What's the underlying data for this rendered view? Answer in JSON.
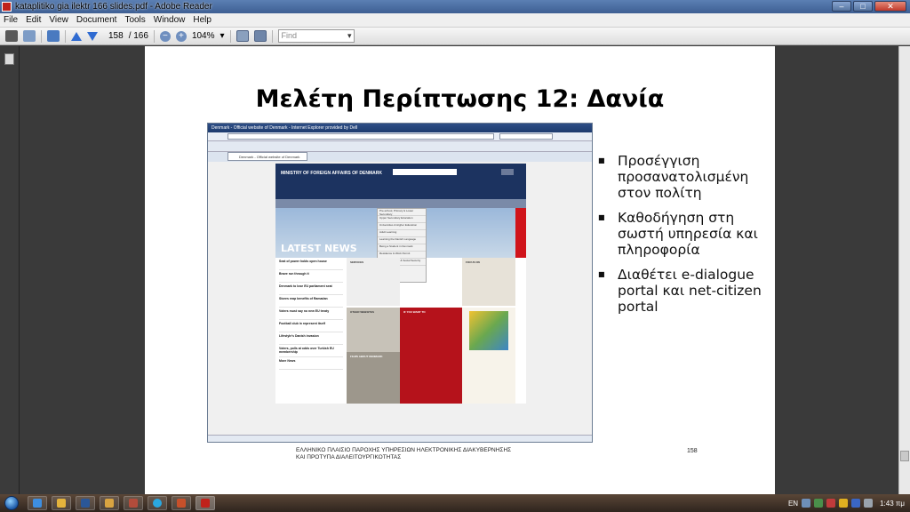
{
  "window": {
    "title": "kataplitiko gia ilektr 166 slides.pdf - Adobe Reader",
    "controls": [
      "–",
      "□",
      "✕"
    ]
  },
  "menu": {
    "items": [
      "File",
      "Edit",
      "View",
      "Document",
      "Tools",
      "Window",
      "Help"
    ]
  },
  "toolbar": {
    "current_page": "158",
    "total_pages": "/ 166",
    "zoom": "104%",
    "find_placeholder": "Find"
  },
  "slide": {
    "title": "Μελέτη Περίπτωσης 12: Δανία",
    "bullets": [
      "Προσέγγιση προσανατολισμένη στον πολίτη",
      "Καθοδήγηση στη σωστή υπηρεσία και πληροφορία",
      "Διαθέτει e-dialogue portal και net-citizen portal"
    ],
    "footer_line1": "ΕΛΛΗΝΙΚΟ ΠΛΑΙΣΙΟ ΠΑΡΟΧΗΣ ΥΠΗΡΕΣΙΩΝ ΗΛΕΚΤΡΟΝΙΚΗΣ ΔΙΑΚΥΒΕΡΝΗΣΗΣ",
    "footer_line2": "ΚΑΙ ΠΡΟΤΥΠΑ ΔΙΑΛΕΙΤΟΥΡΓΙΚΟΤΗΤΑΣ",
    "page_number": "158"
  },
  "screenshot": {
    "ie_title": "Denmark - Official website of Denmark - Internet Explorer provided by Dell",
    "tab_label": "Denmark - Official website of Denmark",
    "site_header": "MINISTRY OF FOREIGN AFFAIRS OF DENMARK",
    "banner_text": "LATEST NEWS",
    "dropdown_items": [
      "Pre-school, Primary & Lower Secondary",
      "Upper Secondary Education",
      "Universities & Higher Education",
      "Adult Learning",
      "Learning the Danish Language",
      "Being a Student in Denmark",
      "Residence & Work Permit",
      "Health Insurance & Social Security"
    ],
    "news_items": [
      "Seat of power holds open house",
      "Brave run through it",
      "Denmark to lose EU parliament seat",
      "Stores reap benefits of Ramadan",
      "Voters must say no new EU treaty",
      "Football club in represent itself",
      "Lifestyle's Danish invasion",
      "Voters, polls at odds over Turkish EU membership",
      "More News"
    ],
    "section_services": "SERVICES",
    "section_focus": "FOCUS ON",
    "section_other": "OTHER WEBSITES",
    "section_films": "FILMS ABOUT DENMARK",
    "section_ifyou": "IF YOU WANT TO"
  },
  "taskbar": {
    "language": "EN",
    "clock": "1:43 πμ"
  },
  "colors": {
    "accent": "#2f6bd1",
    "site_header": "#1c3360",
    "site_red": "#b5121b"
  }
}
